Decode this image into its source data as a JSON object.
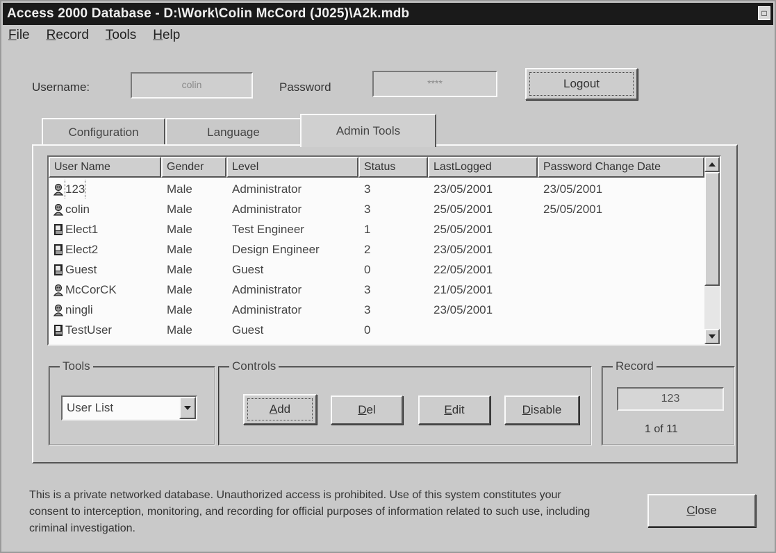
{
  "window": {
    "title": "Access 2000 Database - D:\\Work\\Colin McCord (J025)\\A2k.mdb"
  },
  "menu": [
    "File",
    "Record",
    "Tools",
    "Help"
  ],
  "login": {
    "username_label": "Username:",
    "username_value": "colin",
    "password_label": "Password",
    "password_value": "****",
    "logout_label": "Logout"
  },
  "tabs": [
    "Configuration",
    "Language",
    "Admin Tools"
  ],
  "active_tab": "Admin Tools",
  "list": {
    "columns": [
      "User Name",
      "Gender",
      "Level",
      "Status",
      "LastLogged",
      "Password Change Date"
    ],
    "rows": [
      {
        "icon": "admin-user-icon",
        "name": "123",
        "gender": "Male",
        "level": "Administrator",
        "status": "3",
        "last": "23/05/2001",
        "pwdate": "23/05/2001"
      },
      {
        "icon": "admin-user-icon",
        "name": "colin",
        "gender": "Male",
        "level": "Administrator",
        "status": "3",
        "last": "25/05/2001",
        "pwdate": "25/05/2001"
      },
      {
        "icon": "user-icon",
        "name": "Elect1",
        "gender": "Male",
        "level": "Test Engineer",
        "status": "1",
        "last": "25/05/2001",
        "pwdate": ""
      },
      {
        "icon": "user-icon",
        "name": "Elect2",
        "gender": "Male",
        "level": "Design Engineer",
        "status": "2",
        "last": "23/05/2001",
        "pwdate": ""
      },
      {
        "icon": "user-icon",
        "name": "Guest",
        "gender": "Male",
        "level": "Guest",
        "status": "0",
        "last": "22/05/2001",
        "pwdate": ""
      },
      {
        "icon": "admin-user-icon",
        "name": "McCorCK",
        "gender": "Male",
        "level": "Administrator",
        "status": "3",
        "last": "21/05/2001",
        "pwdate": ""
      },
      {
        "icon": "admin-user-icon",
        "name": "ningli",
        "gender": "Male",
        "level": "Administrator",
        "status": "3",
        "last": "23/05/2001",
        "pwdate": ""
      },
      {
        "icon": "user-icon",
        "name": "TestUser",
        "gender": "Male",
        "level": "Guest",
        "status": "0",
        "last": "",
        "pwdate": ""
      }
    ]
  },
  "tools": {
    "title": "Tools",
    "selected": "User List"
  },
  "controls": {
    "title": "Controls",
    "add": "Add",
    "del": "Del",
    "edit": "Edit",
    "disable": "Disable"
  },
  "record": {
    "title": "Record",
    "current": "123",
    "position": "1 of 11"
  },
  "disclaimer": "This is a private networked database. Unauthorized access is prohibited. Use of this system constitutes your consent to interception, monitoring, and recording for official purposes of information related to such use, including criminal investigation.",
  "close_label": "Close"
}
